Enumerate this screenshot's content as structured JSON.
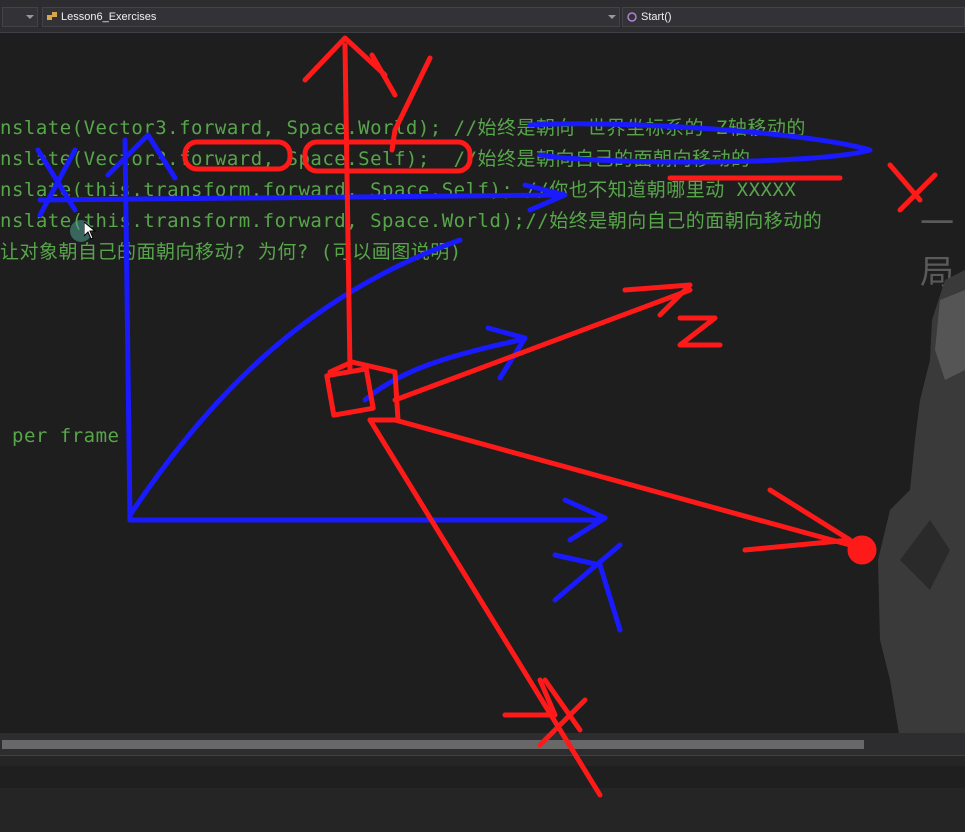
{
  "navbar": {
    "left_dropdown": "",
    "class_dropdown": "Lesson6_Exercises",
    "member_dropdown": "Start()"
  },
  "code": {
    "lines": [
      "nslate(Vector3.forward, Space.World); //始终是朝向 世界坐标系的 Z轴移动的",
      "nslate(Vector3.forward, Space.Self);  //始终是朝向自己的面朝向移动的",
      "nslate(this.transform.forward, Space.Self); //你也不知道朝哪里动 XXXXX",
      "nslate(this.transform.forward, Space.World);//始终是朝向自己的面朝向移动的",
      "让对象朝自己的面朝向移动? 为何? (可以画图说明)",
      "per frame"
    ]
  },
  "overlay_text": "一局",
  "colors": {
    "accent_red": "#ff1a1a",
    "accent_blue": "#1a1aff",
    "comment_green": "#57a64a",
    "editor_bg": "#1e1e1e"
  },
  "annotation_labels": {
    "red_y": "y",
    "red_z": "z",
    "red_x_top": "x",
    "red_x_bottom": "x",
    "blue_y": "y",
    "blue_x": "x"
  }
}
